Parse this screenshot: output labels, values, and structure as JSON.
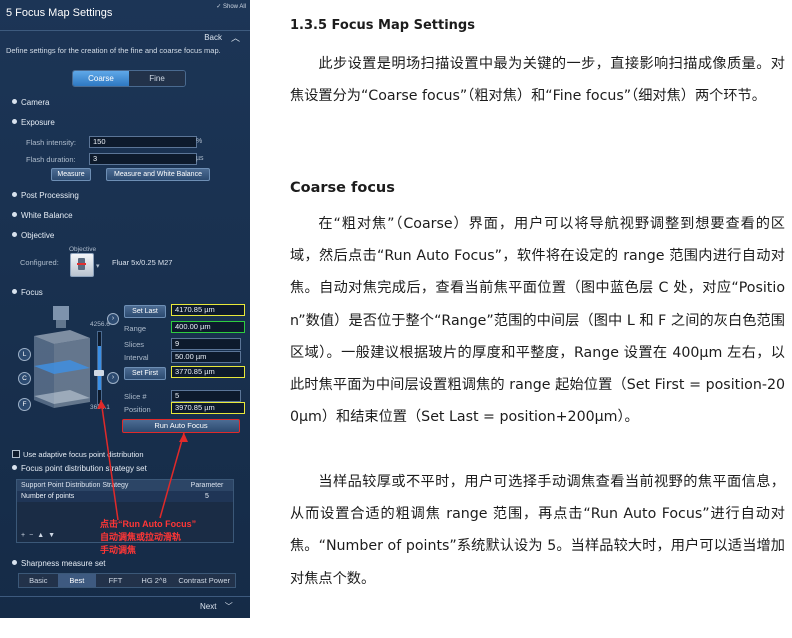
{
  "panel": {
    "title": "5   Focus Map Settings",
    "show_all": "Show All",
    "back_label": "Back",
    "description": "Define settings for the creation of the fine and coarse focus map.",
    "tabs": [
      "Coarse",
      "Fine"
    ],
    "sections": {
      "camera": "Camera",
      "exposure": "Exposure",
      "post_processing": "Post Processing",
      "white_balance": "White Balance",
      "objective": "Objective",
      "focus": "Focus"
    },
    "exposure": {
      "flash_intensity_label": "Flash intensity:",
      "flash_intensity_value": "150",
      "flash_intensity_unit": "%",
      "flash_duration_label": "Flash duration:",
      "flash_duration_value": "3",
      "flash_duration_unit": "µs",
      "measure_button": "Measure",
      "measure_wb_button": "Measure and White Balance"
    },
    "objective": {
      "configured_label": "Configured:",
      "header": "Objective",
      "name": "Fluar 5x/0.25 M27"
    },
    "focus": {
      "top_value": "4256.6",
      "bottom_value": "3685.1",
      "set_last_button": "Set Last",
      "set_last_value": "4170.85 µm",
      "range_label": "Range",
      "range_value": "400.00 µm",
      "slices_label": "Slices",
      "slices_value": "9",
      "interval_label": "Interval",
      "interval_value": "50.00 µm",
      "set_first_button": "Set First",
      "set_first_value": "3770.85 µm",
      "slice_num_label": "Slice #",
      "slice_num_value": "5",
      "position_label": "Position",
      "position_value": "3970.85 µm",
      "run_autofocus_button": "Run Auto Focus",
      "markers": [
        "L",
        "C",
        "F"
      ]
    },
    "adaptive_checkbox": "Use adaptive focus point distribution",
    "strategy_section": "Focus point distribution strategy set",
    "table": {
      "headers": [
        "Support Point Distribution Strategy",
        "Parameter"
      ],
      "rows": [
        [
          "Number of points",
          "5"
        ]
      ]
    },
    "annotation": [
      "点击“Run Auto Focus”",
      "自动调焦或拉动滑轨",
      "手动调焦"
    ],
    "sharpness_section": "Sharpness measure set",
    "sharpness_tabs": [
      "Basic",
      "Best",
      "FFT",
      "HG 2^8",
      "Contrast Power"
    ],
    "next_label": "Next"
  },
  "doc": {
    "heading": "1.3.5 Focus Map Settings",
    "para1": "此步设置是明场扫描设置中最为关键的一步，直接影响扫描成像质量。对焦设置分为“Coarse focus”（粗对焦）和“Fine focus”（细对焦）两个环节。",
    "subheading": "Coarse focus",
    "para2": "在“粗对焦”（Coarse）界面，用户可以将导航视野调整到想要查看的区域，然后点击“Run Auto Focus”，软件将在设定的 range 范围内进行自动对焦。自动对焦完成后，查看当前焦平面位置（图中蓝色层 C 处，对应“Position”数值）是否位于整个“Range”范围的中间层（图中 L 和 F 之间的灰白色范围区域）。一般建议根据玻片的厚度和平整度，Range 设置在 400μm 左右，以此时焦平面为中间层设置粗调焦的 range 起始位置（Set First = position-200μm）和结束位置（Set Last = position+200μm）。",
    "para3": "当样品较厚或不平时，用户可选择手动调焦查看当前视野的焦平面信息，从而设置合适的粗调焦 range 范围，再点击“Run Auto Focus”进行自动对焦。“Number of points”系统默认设为 5。当样品较大时，用户可以适当增加对焦点个数。"
  }
}
